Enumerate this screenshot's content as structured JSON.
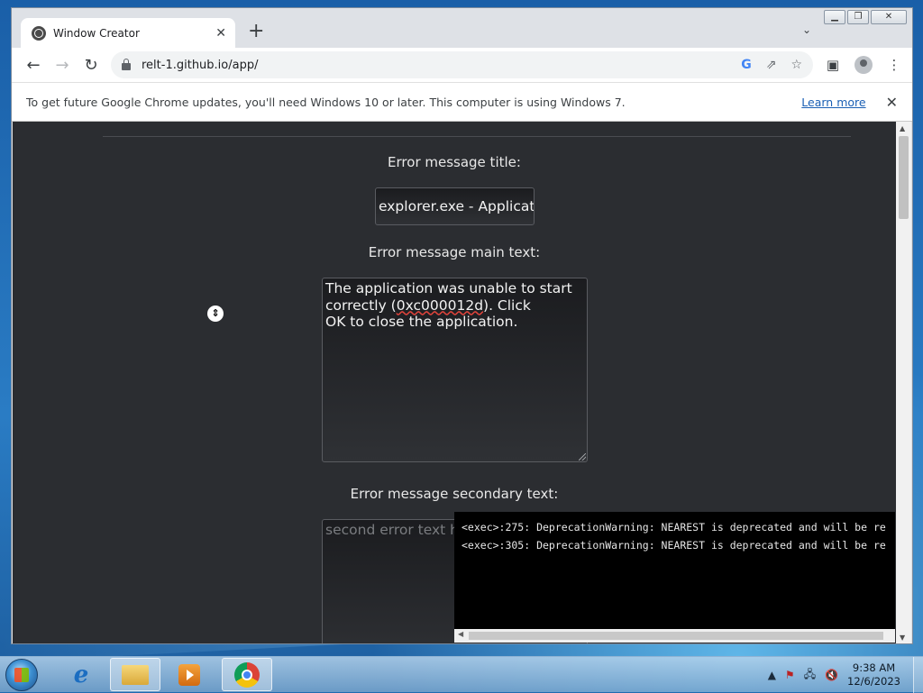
{
  "browser": {
    "tab_title": "Window Creator",
    "new_tab_symbol": "+",
    "url": "relt-1.github.io/app/",
    "infobar_text": "To get future Google Chrome updates, you'll need Windows 10 or later. This computer is using Windows 7.",
    "infobar_link": "Learn more"
  },
  "page": {
    "title_label": "Error message title:",
    "title_value": "explorer.exe - Applicatio",
    "main_label": "Error message main text:",
    "main_line1": "The application was unable to start",
    "main_line2_pre": "correctly (",
    "main_line2_err": "0xc000012d",
    "main_line2_post": "). Click",
    "main_line3": "OK to close the application.",
    "secondary_label": "Error message secondary text:",
    "secondary_placeholder": "second error text her"
  },
  "console": {
    "lines": [
      "<exec>:275: DeprecationWarning: NEAREST is deprecated and will be re",
      "<exec>:305: DeprecationWarning: NEAREST is deprecated and will be re"
    ]
  },
  "taskbar": {
    "time": "9:38 AM",
    "date": "12/6/2023",
    "apps": [
      "internet-explorer",
      "file-explorer",
      "media-player",
      "google-chrome"
    ]
  },
  "colors": {
    "page_bg": "#2b2d31",
    "console_bg": "#000000",
    "link": "#1a5fb4"
  }
}
